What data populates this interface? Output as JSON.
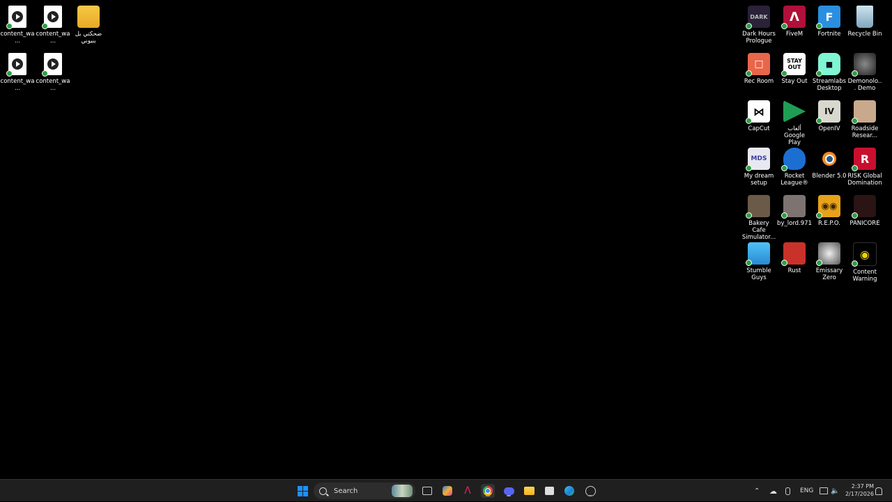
{
  "desktop": {
    "left_icons": [
      {
        "label": "content_wa...",
        "icon": "video-file-icon"
      },
      {
        "label": "content_wa...",
        "icon": "video-file-icon"
      },
      {
        "label": "ضحكتي بل بنيوني",
        "icon": "folder-icon"
      },
      {
        "label": "content_wa...",
        "icon": "video-file-icon"
      },
      {
        "label": "content_wa...",
        "icon": "video-file-icon"
      }
    ],
    "right_icons": [
      {
        "label": "Dark Hours Prologue",
        "icon": "dark-hours-icon"
      },
      {
        "label": "FiveM",
        "icon": "fivem-icon"
      },
      {
        "label": "Fortnite",
        "icon": "fortnite-icon"
      },
      {
        "label": "Recycle Bin",
        "icon": "recycle-bin-icon"
      },
      {
        "label": "Rec Room",
        "icon": "rec-room-icon"
      },
      {
        "label": "Stay Out",
        "icon": "stay-out-icon"
      },
      {
        "label": "Streamlabs Desktop",
        "icon": "streamlabs-icon"
      },
      {
        "label": "Demonolo... Demo",
        "icon": "demonologist-icon"
      },
      {
        "label": "CapCut",
        "icon": "capcut-icon"
      },
      {
        "label": "ألعاب Google Play",
        "icon": "google-play-games-icon"
      },
      {
        "label": "OpenIV",
        "icon": "openiv-icon"
      },
      {
        "label": "Roadside Resear...",
        "icon": "roadside-research-icon"
      },
      {
        "label": "My dream setup",
        "icon": "my-dream-setup-icon"
      },
      {
        "label": "Rocket League®",
        "icon": "rocket-league-icon"
      },
      {
        "label": "Blender 5.0",
        "icon": "blender-icon"
      },
      {
        "label": "RISK Global Domination",
        "icon": "risk-icon"
      },
      {
        "label": "Bakery Cafe Simulator...",
        "icon": "bakery-cafe-icon"
      },
      {
        "label": "by_lord.971",
        "icon": "by-lord-icon"
      },
      {
        "label": "R.E.P.O.",
        "icon": "repo-icon"
      },
      {
        "label": "PANICORE",
        "icon": "panicore-icon"
      },
      {
        "label": "Stumble Guys",
        "icon": "stumble-guys-icon"
      },
      {
        "label": "Rust",
        "icon": "rust-icon"
      },
      {
        "label": "Emissary Zero",
        "icon": "emissary-zero-icon"
      },
      {
        "label": "Content Warning",
        "icon": "content-warning-icon"
      }
    ]
  },
  "taskbar": {
    "search_placeholder": "Search",
    "language": "ENG",
    "time": "2:37 PM",
    "date": "2/17/2026",
    "pinned": [
      "start-icon",
      "task-view-icon",
      "copilot-icon",
      "fivem-icon",
      "chrome-icon",
      "discord-icon",
      "file-explorer-icon",
      "store-icon",
      "edge-icon",
      "app-icon"
    ]
  },
  "colors": {
    "desktop_bg": "#000000",
    "taskbar_bg": "#1f1f1f",
    "windows_blue": "#1e90ff"
  }
}
